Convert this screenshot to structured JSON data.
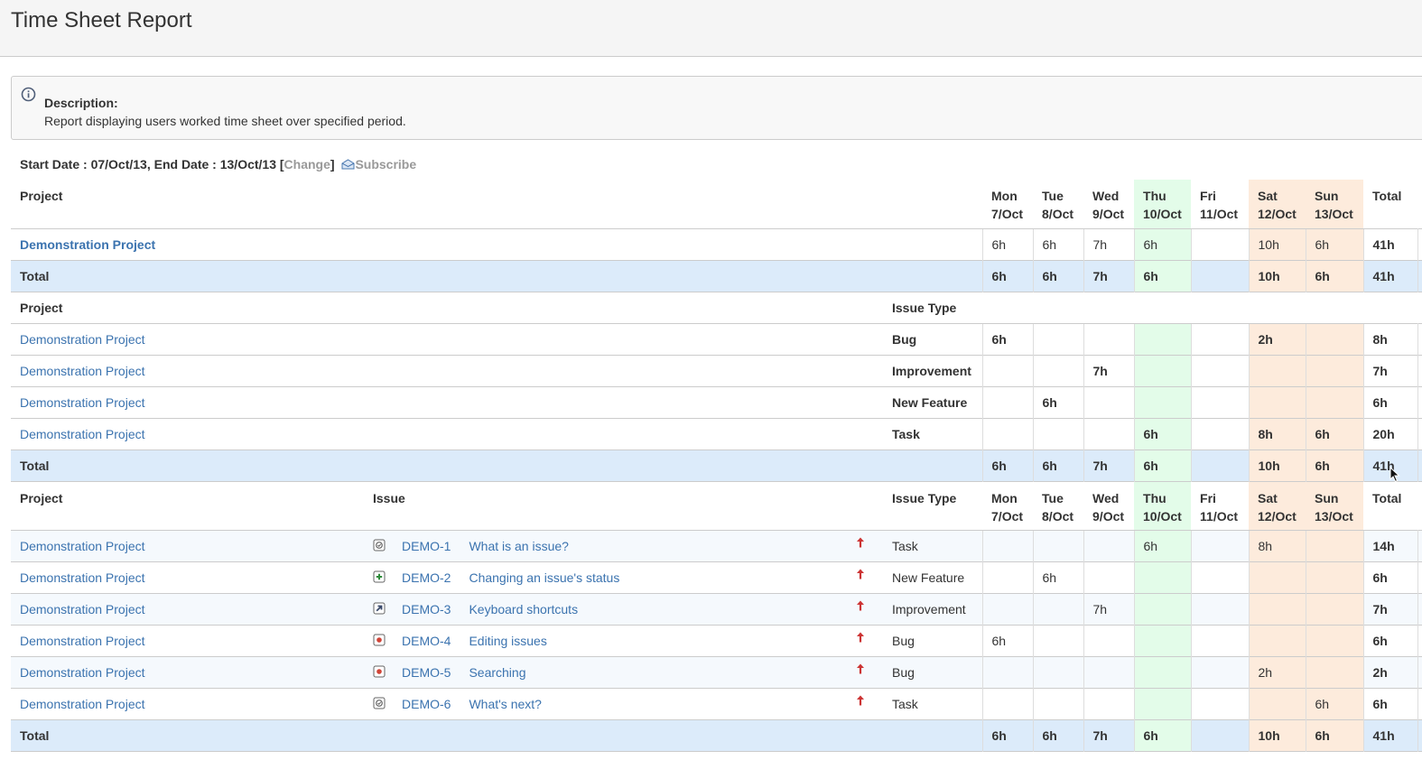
{
  "header": {
    "title": "Time Sheet Report"
  },
  "description": {
    "icon": "info-icon",
    "title": "Description:",
    "text": "Report displaying users worked time sheet over specified period."
  },
  "date_line": {
    "text": "Start Date : 07/Oct/13, End Date : 13/Oct/13 [",
    "change_label": "Change",
    "close_bracket": "]",
    "subscribe_icon": "subscribe-envelope-icon",
    "subscribe_label": "Subscribe"
  },
  "days": [
    {
      "dow": "Mon",
      "date": "7/Oct",
      "kind": "normal"
    },
    {
      "dow": "Tue",
      "date": "8/Oct",
      "kind": "normal"
    },
    {
      "dow": "Wed",
      "date": "9/Oct",
      "kind": "normal"
    },
    {
      "dow": "Thu",
      "date": "10/Oct",
      "kind": "today"
    },
    {
      "dow": "Fri",
      "date": "11/Oct",
      "kind": "normal"
    },
    {
      "dow": "Sat",
      "date": "12/Oct",
      "kind": "weekend"
    },
    {
      "dow": "Sun",
      "date": "13/Oct",
      "kind": "weekend"
    }
  ],
  "labels": {
    "project": "Project",
    "issue": "Issue",
    "issue_type": "Issue Type",
    "total": "Total"
  },
  "colors": {
    "link": "#3b73af",
    "today_bg": "#e3fce9",
    "weekend_bg": "#fdebdc",
    "total_row_bg": "#dcebfa",
    "priority_arrow": "#cc3333"
  },
  "section1": {
    "rows": [
      {
        "project": "Demonstration Project",
        "hours": [
          "6h",
          "6h",
          "7h",
          "6h",
          "",
          "10h",
          "6h"
        ],
        "total": "41h"
      }
    ],
    "totals": {
      "hours": [
        "6h",
        "6h",
        "7h",
        "6h",
        "",
        "10h",
        "6h"
      ],
      "total": "41h"
    }
  },
  "section2": {
    "rows": [
      {
        "project": "Demonstration Project",
        "issue_type": "Bug",
        "hours": [
          "6h",
          "",
          "",
          "",
          "",
          "2h",
          ""
        ],
        "total": "8h"
      },
      {
        "project": "Demonstration Project",
        "issue_type": "Improvement",
        "hours": [
          "",
          "",
          "7h",
          "",
          "",
          "",
          ""
        ],
        "total": "7h"
      },
      {
        "project": "Demonstration Project",
        "issue_type": "New Feature",
        "hours": [
          "",
          "6h",
          "",
          "",
          "",
          "",
          ""
        ],
        "total": "6h"
      },
      {
        "project": "Demonstration Project",
        "issue_type": "Task",
        "hours": [
          "",
          "",
          "",
          "6h",
          "",
          "8h",
          "6h"
        ],
        "total": "20h"
      }
    ],
    "totals": {
      "hours": [
        "6h",
        "6h",
        "7h",
        "6h",
        "",
        "10h",
        "6h"
      ],
      "total": "41h"
    }
  },
  "section3": {
    "rows": [
      {
        "project": "Demonstration Project",
        "type_icon": "task-icon",
        "key": "DEMO-1",
        "summary": "What is an issue?",
        "priority_icon": "priority-major-icon",
        "issue_type": "Task",
        "hours": [
          "",
          "",
          "",
          "6h",
          "",
          "8h",
          ""
        ],
        "total": "14h"
      },
      {
        "project": "Demonstration Project",
        "type_icon": "new-feature-icon",
        "key": "DEMO-2",
        "summary": "Changing an issue's status",
        "priority_icon": "priority-major-icon",
        "issue_type": "New Feature",
        "hours": [
          "",
          "6h",
          "",
          "",
          "",
          "",
          ""
        ],
        "total": "6h"
      },
      {
        "project": "Demonstration Project",
        "type_icon": "improvement-icon",
        "key": "DEMO-3",
        "summary": "Keyboard shortcuts",
        "priority_icon": "priority-major-icon",
        "issue_type": "Improvement",
        "hours": [
          "",
          "",
          "7h",
          "",
          "",
          "",
          ""
        ],
        "total": "7h"
      },
      {
        "project": "Demonstration Project",
        "type_icon": "bug-icon",
        "key": "DEMO-4",
        "summary": "Editing issues",
        "priority_icon": "priority-major-icon",
        "issue_type": "Bug",
        "hours": [
          "6h",
          "",
          "",
          "",
          "",
          "",
          ""
        ],
        "total": "6h"
      },
      {
        "project": "Demonstration Project",
        "type_icon": "bug-icon",
        "key": "DEMO-5",
        "summary": "Searching",
        "priority_icon": "priority-major-icon",
        "issue_type": "Bug",
        "hours": [
          "",
          "",
          "",
          "",
          "",
          "2h",
          ""
        ],
        "total": "2h"
      },
      {
        "project": "Demonstration Project",
        "type_icon": "task-icon",
        "key": "DEMO-6",
        "summary": "What's next?",
        "priority_icon": "priority-major-icon",
        "issue_type": "Task",
        "hours": [
          "",
          "",
          "",
          "",
          "",
          "",
          "6h"
        ],
        "total": "6h"
      }
    ],
    "totals": {
      "hours": [
        "6h",
        "6h",
        "7h",
        "6h",
        "",
        "10h",
        "6h"
      ],
      "total": "41h"
    }
  }
}
